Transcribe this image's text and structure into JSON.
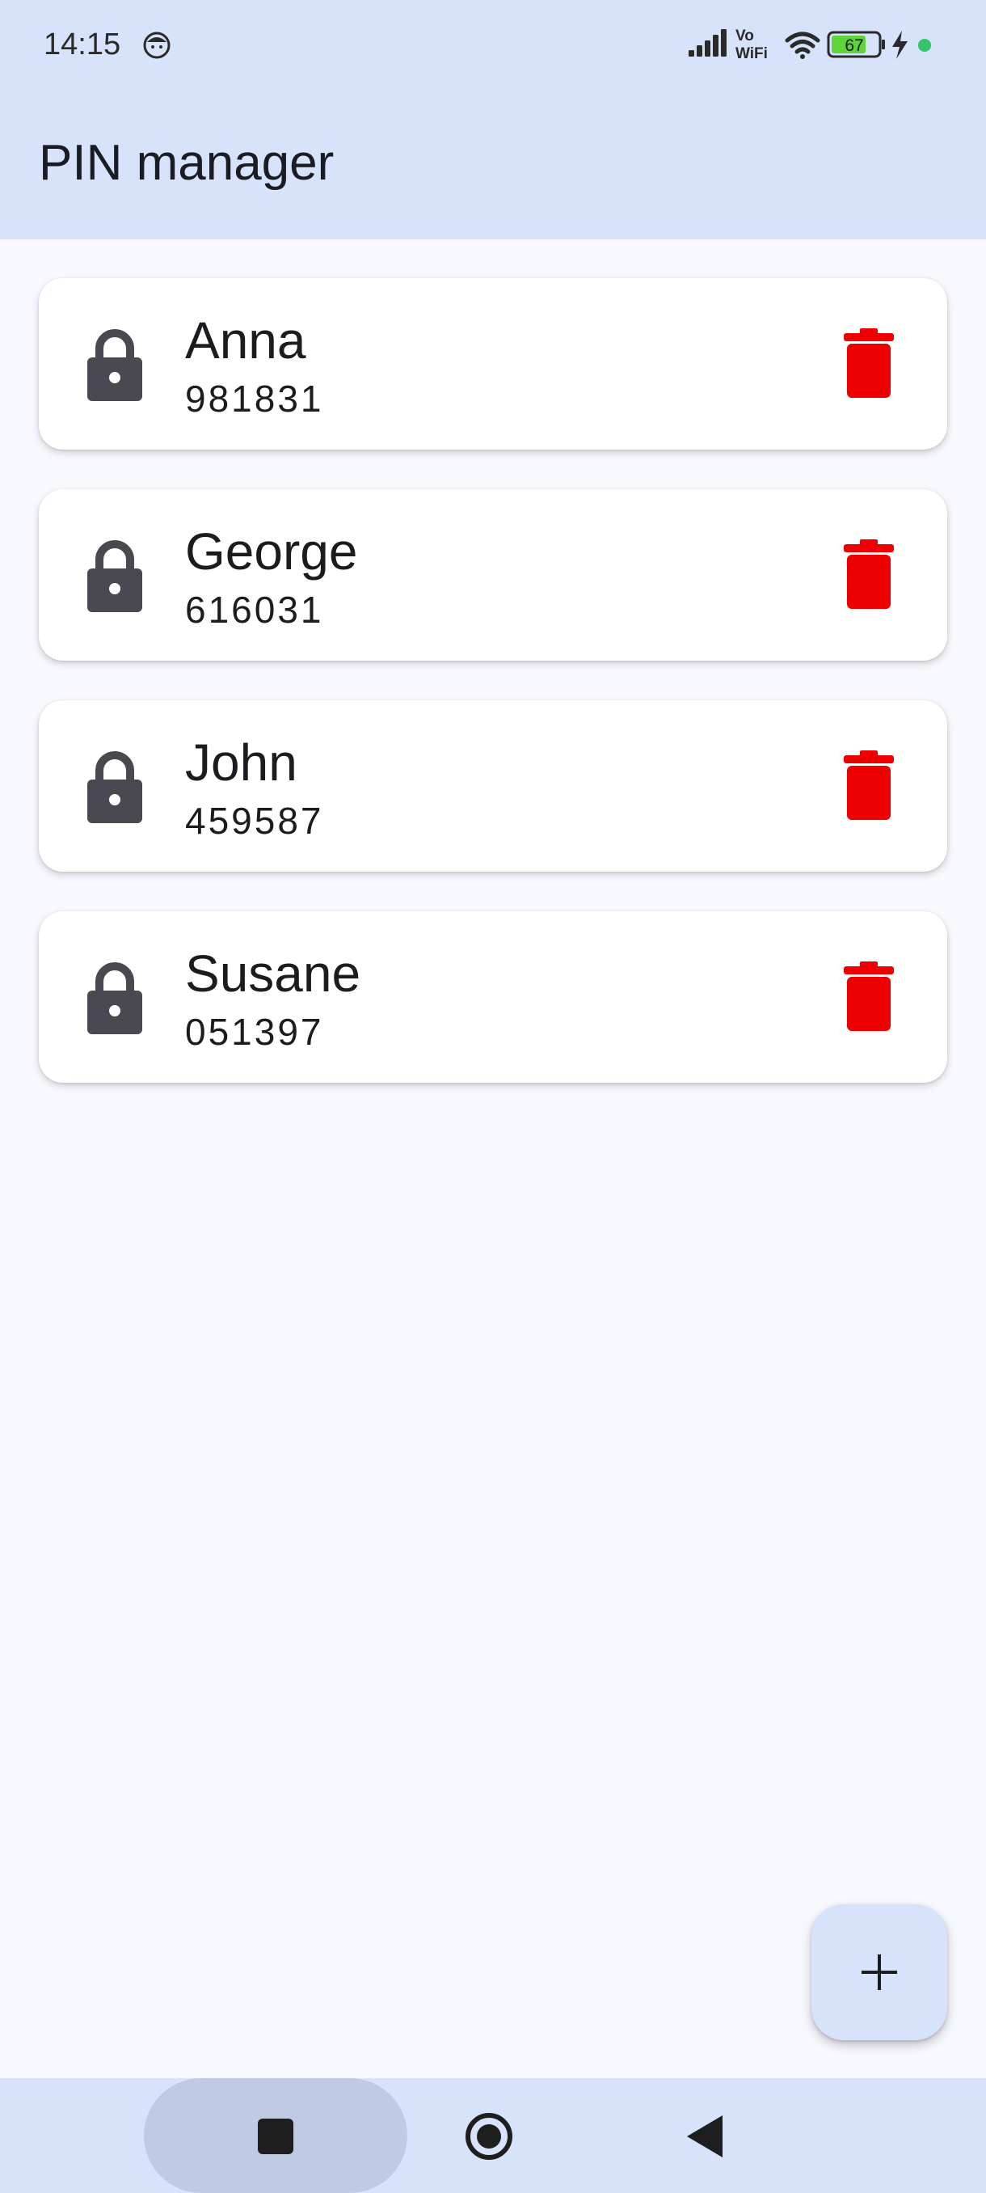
{
  "status_bar": {
    "time": "14:15",
    "battery_level": "67",
    "icons": [
      "face-icon",
      "signal-icon",
      "vowifi-icon",
      "wifi-icon",
      "battery-icon",
      "charging-icon",
      "dot-icon"
    ]
  },
  "app_bar": {
    "title": "PIN manager"
  },
  "pins": [
    {
      "name": "Anna",
      "pin": "981831"
    },
    {
      "name": "George",
      "pin": "616031"
    },
    {
      "name": "John",
      "pin": "459587"
    },
    {
      "name": "Susane",
      "pin": "051397"
    }
  ],
  "colors": {
    "header_bg": "#d6e3fb",
    "page_bg": "#f8f8ff",
    "delete_red": "#ee0000",
    "lock_gray": "#4a4850",
    "battery_green": "#5ed33a",
    "status_dot": "#35c46a"
  },
  "icons": {
    "row_leading": "lock-icon",
    "row_trailing": "trash-icon",
    "fab": "plus-icon",
    "nav": [
      "square-icon",
      "home-circle-icon",
      "back-triangle-icon"
    ]
  }
}
